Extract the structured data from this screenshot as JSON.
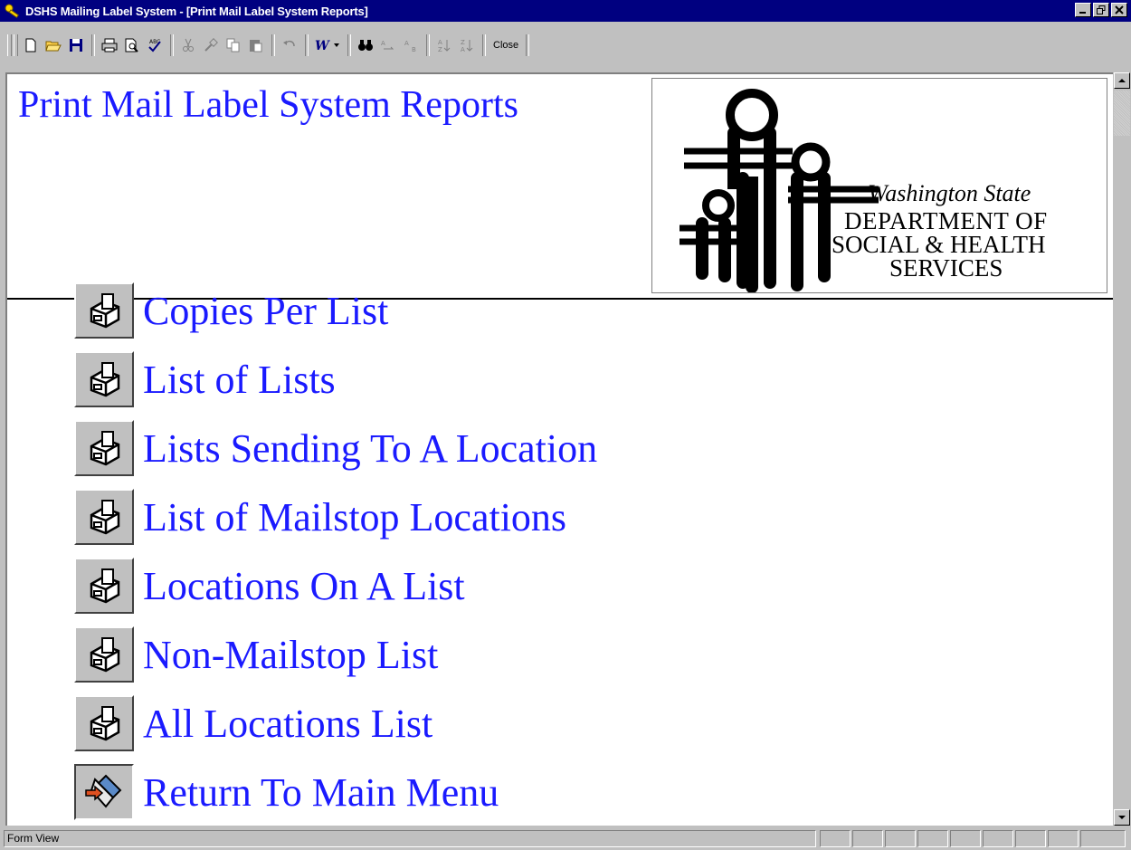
{
  "window": {
    "title": "DSHS Mailing Label System - [Print Mail Label System Reports]"
  },
  "toolbar": {
    "close_label": "Close"
  },
  "page": {
    "title": "Print Mail Label System Reports"
  },
  "logo": {
    "line1": "Washington State",
    "line2": "DEPARTMENT OF",
    "line3": "SOCIAL & HEALTH",
    "line4": "SERVICES"
  },
  "menu": {
    "items": [
      {
        "label": "Copies Per List",
        "icon": "report-icon"
      },
      {
        "label": "List of Lists",
        "icon": "report-icon"
      },
      {
        "label": "Lists Sending To A Location",
        "icon": "report-icon"
      },
      {
        "label": "List of Mailstop Locations",
        "icon": "report-icon"
      },
      {
        "label": "Locations On A List",
        "icon": "report-icon"
      },
      {
        "label": "Non-Mailstop List",
        "icon": "report-icon"
      },
      {
        "label": "All Locations List",
        "icon": "report-icon"
      },
      {
        "label": "Return To Main Menu",
        "icon": "return-icon"
      }
    ]
  },
  "status": {
    "text": "Form View"
  }
}
